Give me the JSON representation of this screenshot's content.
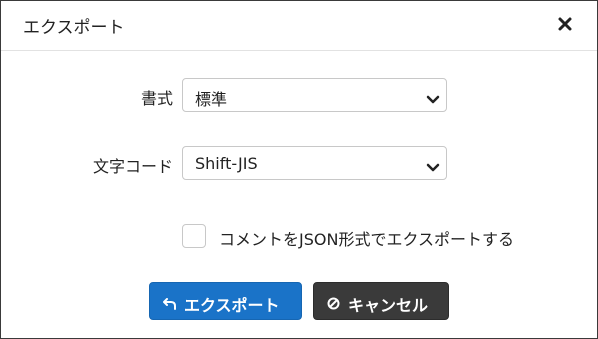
{
  "dialog": {
    "title": "エクスポート",
    "close_icon": "close-icon"
  },
  "format": {
    "label": "書式",
    "selected": "標準"
  },
  "encoding": {
    "label": "文字コード",
    "selected": "Shift-JIS"
  },
  "json_option": {
    "label": "コメントをJSON形式でエクスポートする",
    "checked": false
  },
  "buttons": {
    "export_label": "エクスポート",
    "export_icon": "undo-arrow-icon",
    "export_color": "#1a73c8",
    "cancel_label": "キャンセル",
    "cancel_icon": "ban-icon",
    "cancel_color": "#3a3a3a"
  }
}
